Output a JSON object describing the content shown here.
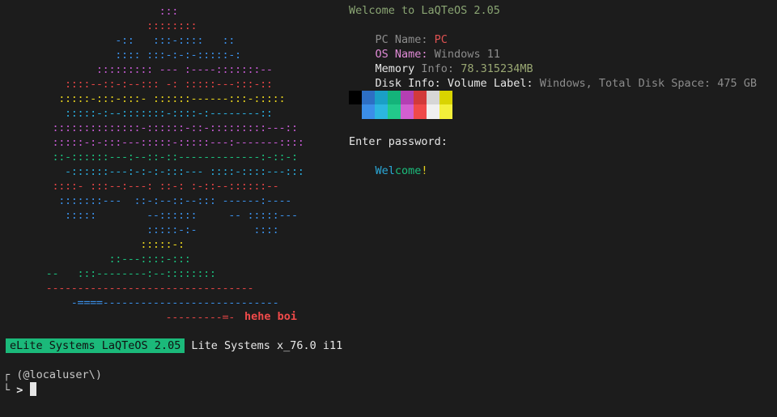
{
  "ascii_art": [
    {
      "text": "                        :::",
      "color": "#c45ad2"
    },
    {
      "text": "                      ::::::::",
      "color": "#e04444"
    },
    {
      "text": "                 -::   :::-::::   ::",
      "color": "#3a8ee6"
    },
    {
      "text": "                 :::: :::-:-:-:::::-:",
      "color": "#3a8ee6"
    },
    {
      "text": "              ::::::::: --- :----:::::::--",
      "color": "#c45ad2"
    },
    {
      "text": "         ::::--::-:--::: -: :::::---:::-::",
      "color": "#e04444"
    },
    {
      "text": "        :::::-:::-:::- ::::::------:::-:::::",
      "color": "#e6d21e"
    },
    {
      "text": "         :::::-:--:::::::-::::-:--------::",
      "color": "#2aa9d9"
    },
    {
      "text": "       ::::::::::::::-::::::-::-:::::::::---::",
      "color": "#c45ad2"
    },
    {
      "text": "       :::::-:-:::---:::::-:::::---:-------::::",
      "color": "#c45ad2"
    },
    {
      "text": "       ::-::::::---:--::-::-------------:-::-:",
      "color": "#1bbd7c"
    },
    {
      "text": "         -::::::---:-:-:-:::--- ::::-::::---:::",
      "color": "#2aa9d9"
    },
    {
      "text": "       ::::- :::--:---: ::-: :-::--::::::--",
      "color": "#e04444"
    },
    {
      "text": "        :::::::---  ::-:--::--::: ------:----",
      "color": "#3a8ee6"
    },
    {
      "text": "         :::::        --::::::     -- :::::---",
      "color": "#3a8ee6"
    },
    {
      "text": "                      :::::-:-         ::::",
      "color": "#3a8ee6"
    },
    {
      "text": "                     :::::-:",
      "color": "#e6d21e"
    },
    {
      "text": "                ::---::::-:::",
      "color": "#1bbd7c"
    },
    {
      "text": "      --   :::--------:--::::::::",
      "color": "#1bbd7c"
    },
    {
      "text": "      ---------------------------------",
      "color": "#e04444"
    },
    {
      "text": "          -====----------------------------",
      "color": "#3a8ee6"
    },
    {
      "text": "                         ---------=-",
      "color": "#e04444"
    }
  ],
  "art_caption": "hehe boi",
  "info": {
    "welcome": "Welcome to LaQTeOS 2.05",
    "pc_key": "PC Name: ",
    "pc_val": "PC",
    "os_key": "OS Name: ",
    "os_val": "Windows 11",
    "mem_key_a": "Memory",
    "mem_key_b": " Info: ",
    "mem_val": "78.315234MB",
    "disk_key": "Disk Info: ",
    "disk_label_key": "Volume Label: ",
    "disk_label_val": "Windows",
    "disk_sep": ", ",
    "disk_total_key": "Total Disk Space: ",
    "disk_total_val": "475 GB",
    "enter_password": "Enter password:",
    "welcome_a": "Wel",
    "welcome_b": "come",
    "welcome_c": "!"
  },
  "palette": {
    "top": [
      "#000000",
      "#2d6fc4",
      "#1a9fc6",
      "#14b37a",
      "#b33fb3",
      "#d23a3a",
      "#d6d6d6",
      "#d9d400"
    ],
    "bottom": [
      "#1c1c1c",
      "#3b8ee8",
      "#2cb6e0",
      "#22c98b",
      "#d25fd1",
      "#f04a4a",
      "#f0f0f0",
      "#f3f03a"
    ]
  },
  "statusbar": {
    "badge": "eLite Systems LaQTeOS 2.05",
    "text": "Lite Systems x_76.0 i11"
  },
  "prompt": {
    "top_left": "┌",
    "user": "(@localuser\\)",
    "bottom_left": "└",
    "gt": ">"
  }
}
